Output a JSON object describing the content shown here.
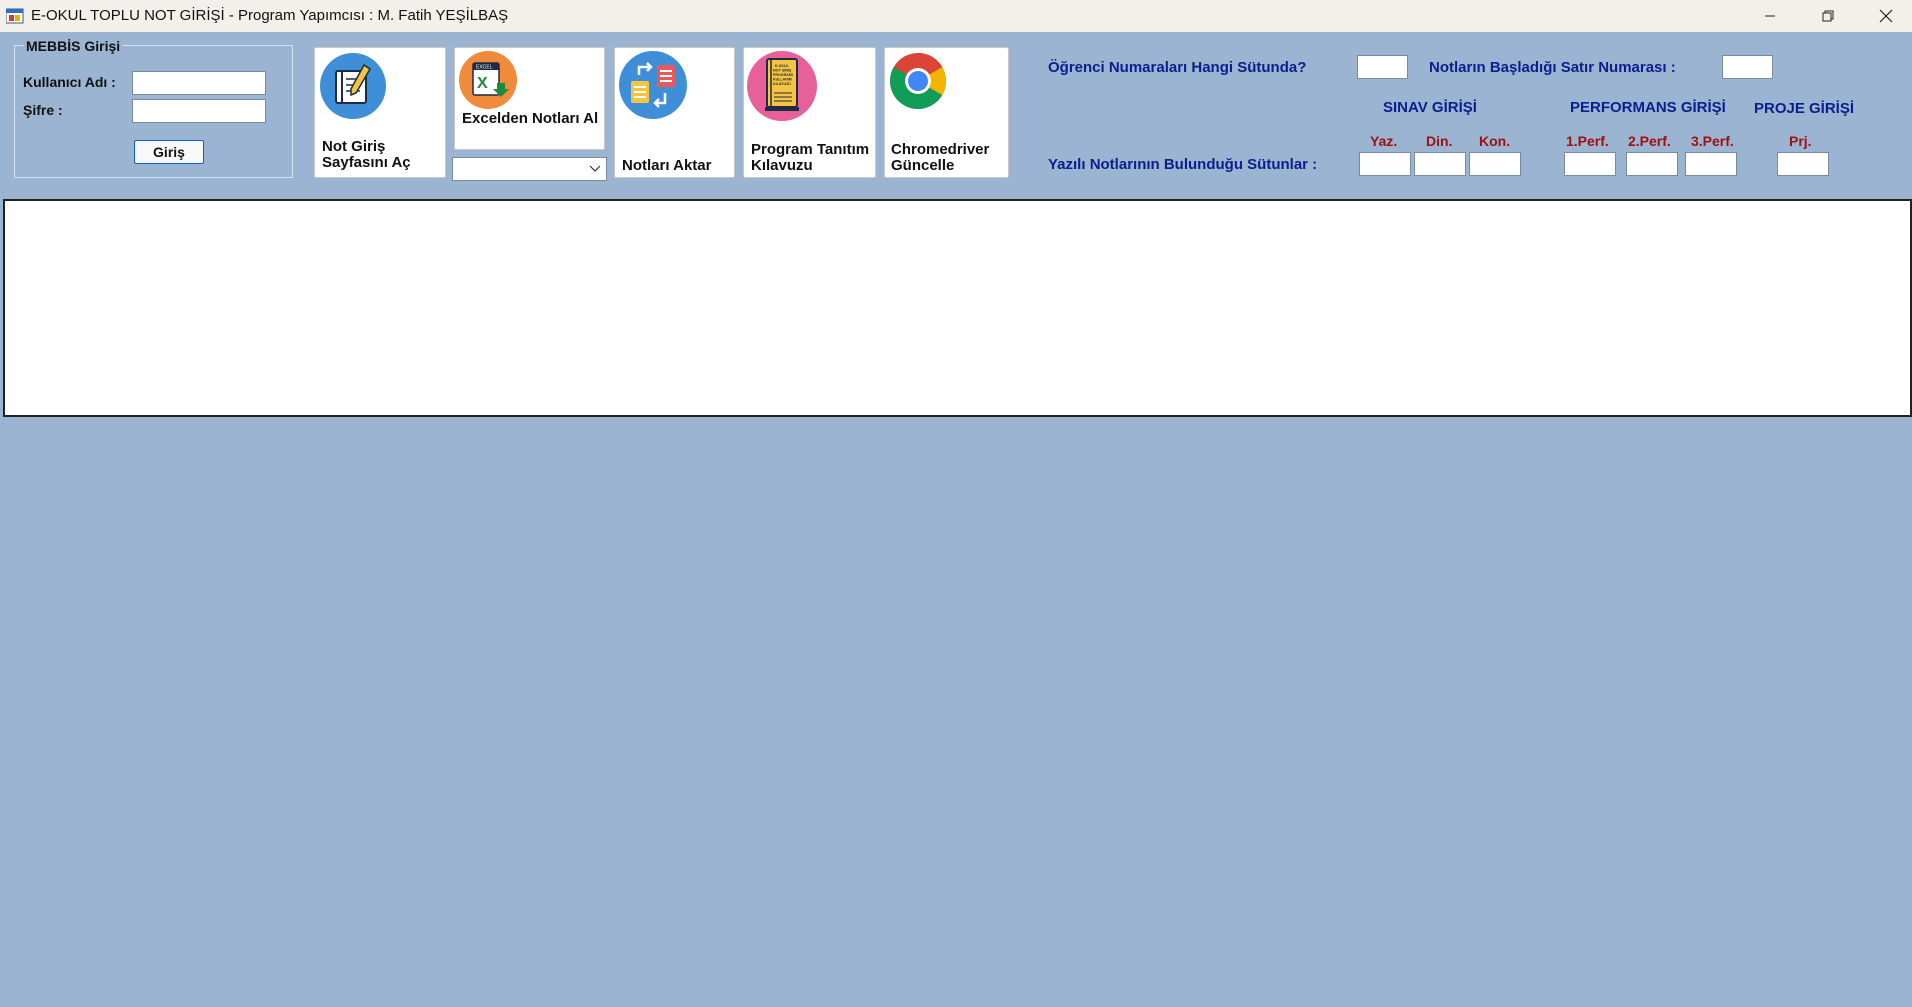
{
  "window": {
    "title": "E-OKUL TOPLU NOT GİRİŞİ - Program Yapımcısı : M. Fatih YEŞİLBAŞ",
    "minimize_icon": "minimize-icon",
    "restore_icon": "restore-icon",
    "close_icon": "close-icon"
  },
  "mebbis": {
    "legend": "MEBBİS Girişi",
    "username_label": "Kullanıcı Adı :",
    "username_value": "",
    "password_label": "Şifre :",
    "password_value": "",
    "login_button": "Giriş"
  },
  "toolbar": {
    "open_page": {
      "label": "Not Giriş Sayfasını Aç",
      "icon": "notebook-icon",
      "color": "#3f8ed8"
    },
    "excel_import": {
      "label": "Excelden Notları Al",
      "icon": "excel-icon",
      "color": "#f08b3c"
    },
    "excel_sheet_selected": "",
    "transfer": {
      "label": "Notları Aktar",
      "icon": "transfer-icon",
      "color": "#3f8ed8"
    },
    "guide": {
      "label": "Program Tanıtım Kılavuzu",
      "icon": "guide-book-icon",
      "color": "#e8609a",
      "book_cover_text": "E-OKUL NOT GİRİŞ PROGRAMI KULLANIM KILAVUZU"
    },
    "chromedriver": {
      "label": "Chromedriver Güncelle",
      "icon": "chrome-icon"
    }
  },
  "settings": {
    "student_column_label": "Öğrenci Numaraları Hangi Sütunda?",
    "student_column_value": "",
    "start_row_label": "Notların Başladığı Satır Numarası :",
    "start_row_value": "",
    "exam_header": "SINAV GİRİŞİ",
    "performance_header": "PERFORMANS GİRİŞİ",
    "project_header": "PROJE GİRİŞİ",
    "columns_label": "Yazılı Notlarının Bulunduğu Sütunlar :",
    "exam_cols": [
      "Yaz.",
      "Din.",
      "Kon."
    ],
    "perf_cols": [
      "1.Perf.",
      "2.Perf.",
      "3.Perf."
    ],
    "project_cols": [
      "Prj."
    ]
  },
  "log": {
    "text": ""
  },
  "colors": {
    "background": "#9bb4d2",
    "label_blue": "#0b1f8c",
    "label_red": "#a01010"
  }
}
